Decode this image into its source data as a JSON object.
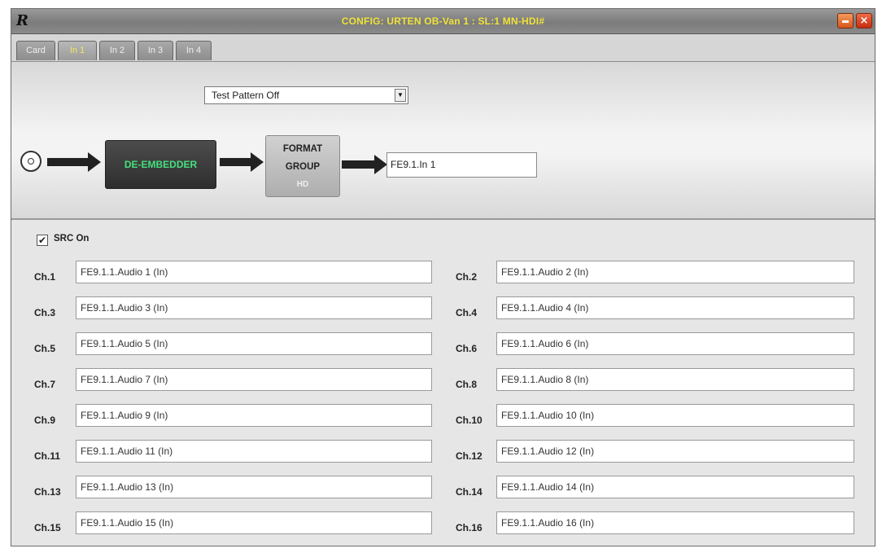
{
  "window": {
    "title": "CONFIG: URTEN OB-Van 1 : SL:1 MN-HDI#",
    "logo_text": "R",
    "close_glyph": "×"
  },
  "tabs": [
    {
      "label": "Card",
      "active": false
    },
    {
      "label": "In 1",
      "active": true
    },
    {
      "label": "In 2",
      "active": false
    },
    {
      "label": "In 3",
      "active": false
    },
    {
      "label": "In 4",
      "active": false
    }
  ],
  "test_pattern": {
    "selected": "Test Pattern Off",
    "arrow_glyph": "▼"
  },
  "signal_flow": {
    "deembedder_label": "DE-EMBEDDER",
    "format_group": {
      "line1": "FORMAT",
      "line2": "GROUP",
      "line3": "HD"
    },
    "output_value": "FE9.1.In 1"
  },
  "src": {
    "label": "SRC On",
    "checked": true,
    "check_glyph": "✔"
  },
  "channels": [
    {
      "label": "Ch.1",
      "value": "FE9.1.1.Audio 1 (In)"
    },
    {
      "label": "Ch.2",
      "value": "FE9.1.1.Audio 2 (In)"
    },
    {
      "label": "Ch.3",
      "value": "FE9.1.1.Audio 3 (In)"
    },
    {
      "label": "Ch.4",
      "value": "FE9.1.1.Audio 4 (In)"
    },
    {
      "label": "Ch.5",
      "value": "FE9.1.1.Audio 5 (In)"
    },
    {
      "label": "Ch.6",
      "value": "FE9.1.1.Audio 6 (In)"
    },
    {
      "label": "Ch.7",
      "value": "FE9.1.1.Audio 7 (In)"
    },
    {
      "label": "Ch.8",
      "value": "FE9.1.1.Audio 8 (In)"
    },
    {
      "label": "Ch.9",
      "value": "FE9.1.1.Audio 9 (In)"
    },
    {
      "label": "Ch.10",
      "value": "FE9.1.1.Audio 10 (In)"
    },
    {
      "label": "Ch.11",
      "value": "FE9.1.1.Audio 11 (In)"
    },
    {
      "label": "Ch.12",
      "value": "FE9.1.1.Audio 12 (In)"
    },
    {
      "label": "Ch.13",
      "value": "FE9.1.1.Audio 13 (In)"
    },
    {
      "label": "Ch.14",
      "value": "FE9.1.1.Audio 14 (In)"
    },
    {
      "label": "Ch.15",
      "value": "FE9.1.1.Audio 15 (In)"
    },
    {
      "label": "Ch.16",
      "value": "FE9.1.1.Audio 16 (In)"
    }
  ]
}
